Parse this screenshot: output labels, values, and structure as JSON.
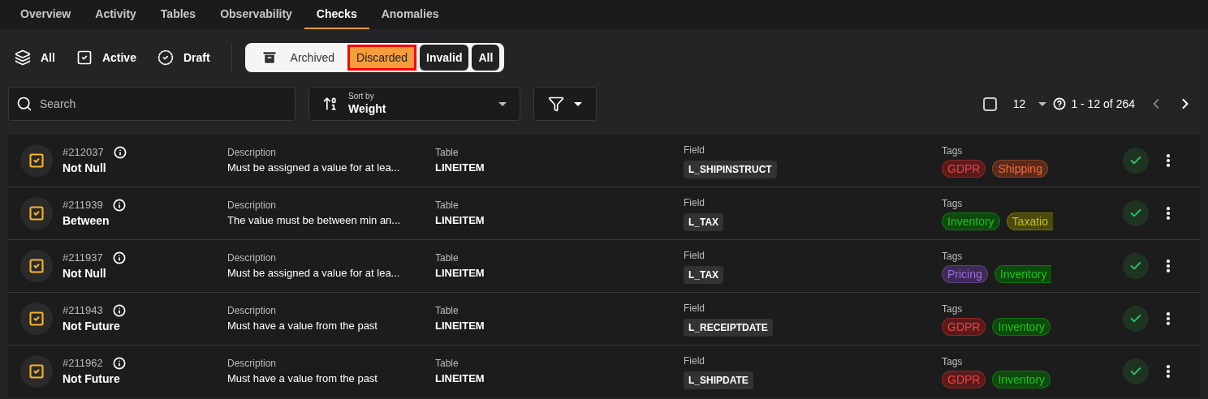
{
  "tabs": [
    {
      "label": "Overview",
      "selected": false
    },
    {
      "label": "Activity",
      "selected": false
    },
    {
      "label": "Tables",
      "selected": false
    },
    {
      "label": "Observability",
      "selected": false
    },
    {
      "label": "Checks",
      "selected": true
    },
    {
      "label": "Anomalies",
      "selected": false
    }
  ],
  "view_filters": [
    {
      "label": "All",
      "kind": "layers"
    },
    {
      "label": "Active",
      "kind": "active"
    },
    {
      "label": "Draft",
      "kind": "draft"
    }
  ],
  "status_filters": [
    {
      "label": "Archived",
      "kind": "archive",
      "selected": false
    },
    {
      "label": "Discarded",
      "kind": "chip",
      "selected": true
    },
    {
      "label": "Invalid",
      "kind": "chip",
      "selected": false
    },
    {
      "label": "All",
      "kind": "chip",
      "selected": false
    }
  ],
  "search": {
    "placeholder": "Search"
  },
  "sort": {
    "label": "Sort by",
    "value": "Weight"
  },
  "pagination": {
    "select_all_checked": false,
    "page_size": "12",
    "range": "1 - 12 of 264"
  },
  "checks": [
    {
      "id": "#212037",
      "type": "Not Null",
      "description_label": "Description",
      "description": "Must be assigned a value for at lea...",
      "table_label": "Table",
      "table": "LINEITEM",
      "field_label": "Field",
      "field": "L_SHIPINSTRUCT",
      "tags_label": "Tags",
      "tags": [
        {
          "label": "GDPR",
          "color": "#5a1a1a",
          "clipped": false
        },
        {
          "label": "Shipping",
          "color": "#5a2a1a",
          "clipped": false
        }
      ]
    },
    {
      "id": "#211939",
      "type": "Between",
      "description_label": "Description",
      "description": "The value must be between min an...",
      "table_label": "Table",
      "table": "LINEITEM",
      "field_label": "Field",
      "field": "L_TAX",
      "tags_label": "Tags",
      "tags": [
        {
          "label": "Inventory",
          "color": "#0d4a0d",
          "clipped": false
        },
        {
          "label": "Taxatio",
          "color": "#4a4a0a",
          "clipped": true
        }
      ]
    },
    {
      "id": "#211937",
      "type": "Not Null",
      "description_label": "Description",
      "description": "Must be assigned a value for at lea...",
      "table_label": "Table",
      "table": "LINEITEM",
      "field_label": "Field",
      "field": "L_TAX",
      "tags_label": "Tags",
      "tags": [
        {
          "label": "Pricing",
          "color": "#3d2a55",
          "clipped": false
        },
        {
          "label": "Inventory",
          "color": "#0d4a0d",
          "clipped": true
        }
      ]
    },
    {
      "id": "#211943",
      "type": "Not Future",
      "description_label": "Description",
      "description": "Must have a value from the past",
      "table_label": "Table",
      "table": "LINEITEM",
      "field_label": "Field",
      "field": "L_RECEIPTDATE",
      "tags_label": "Tags",
      "tags": [
        {
          "label": "GDPR",
          "color": "#5a1a1a",
          "clipped": false
        },
        {
          "label": "Inventory",
          "color": "#0d4a0d",
          "clipped": false
        }
      ]
    },
    {
      "id": "#211962",
      "type": "Not Future",
      "description_label": "Description",
      "description": "Must have a value from the past",
      "table_label": "Table",
      "table": "LINEITEM",
      "field_label": "Field",
      "field": "L_SHIPDATE",
      "tags_label": "Tags",
      "tags": [
        {
          "label": "GDPR",
          "color": "#5a1a1a",
          "clipped": false
        },
        {
          "label": "Inventory",
          "color": "#0d4a0d",
          "clipped": false
        }
      ]
    }
  ]
}
